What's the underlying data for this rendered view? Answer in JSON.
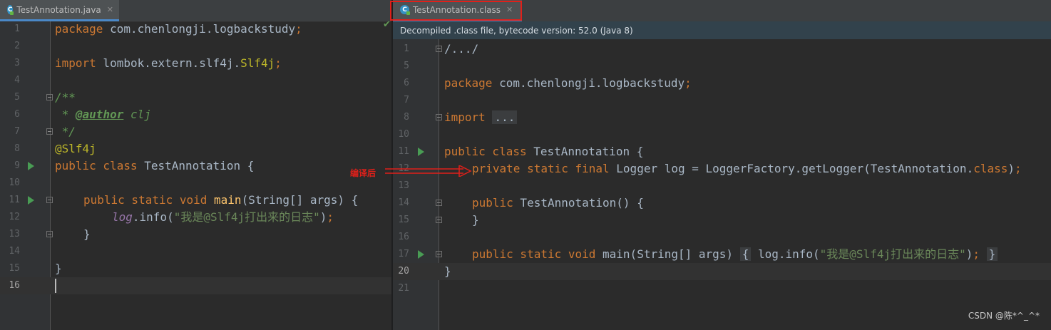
{
  "left_editor": {
    "tab_label": "TestAnnotation.java",
    "tab_icon": "C",
    "line_numbers": [
      "1",
      "2",
      "3",
      "4",
      "5",
      "6",
      "7",
      "8",
      "9",
      "10",
      "11",
      "12",
      "13",
      "14",
      "15",
      "16"
    ],
    "lines": {
      "l1_kw": "package",
      "l1_rest": " com.chenlongji.logbackstudy",
      "l1_semi": ";",
      "l3_kw": "import",
      "l3_rest": " lombok.extern.slf4j.",
      "l3_cls": "Slf4j",
      "l3_semi": ";",
      "l5": "/**",
      "l6_star": " * ",
      "l6_tag": "@author",
      "l6_name": " clj",
      "l7": " */",
      "l8": "@Slf4j",
      "l9_kw": "public class",
      "l9_rest": " TestAnnotation {",
      "l11_kw": "public static void",
      "l11_sp": " ",
      "l11_mth": "main",
      "l11_rest": "(String[] args) {",
      "l12_fld": "log",
      "l12_rest": ".info(",
      "l12_str": "\"我是@Slf4j打出来的日志\"",
      "l12_end": ")",
      "l12_semi": ";",
      "l13": "}",
      "l15": "}"
    }
  },
  "right_editor": {
    "tab_label": "TestAnnotation.class",
    "tab_icon": "C",
    "banner": "Decompiled .class file, bytecode version: 52.0 (Java 8)",
    "line_numbers": [
      "1",
      "5",
      "6",
      "7",
      "8",
      "10",
      "11",
      "12",
      "13",
      "14",
      "15",
      "16",
      "17",
      "20",
      "21"
    ],
    "lines": {
      "r1": "/.../",
      "r6_kw": "package",
      "r6_rest": " com.chenlongji.logbackstudy",
      "r6_semi": ";",
      "r8_kw": "import",
      "r8_fold": "...",
      "r11_kw": "public class",
      "r11_rest": " TestAnnotation {",
      "r12_kw": "private static final",
      "r12_rest": " Logger log = LoggerFactory.getLogger(TestAnnotation.",
      "r12_cls": "class",
      "r12_end": ")",
      "r12_semi": ";",
      "r14_kw": "public",
      "r14_rest": " TestAnnotation() {",
      "r15": "}",
      "r17_kw": "public static void",
      "r17_rest": " main(String[] args)",
      "r17_open": "{",
      "r17_call": " log.info(",
      "r17_str": "\"我是@Slf4j打出来的日志\"",
      "r17_end": ")",
      "r17_semi": ";",
      "r17_close": "}",
      "r20": "}"
    }
  },
  "annotation_label": "编译后",
  "watermark": "CSDN @陈*^_^*",
  "colors": {
    "keyword": "#cc7832",
    "string": "#6a8759",
    "annotation": "#bbb529",
    "highlight_border": "#e0201a"
  }
}
